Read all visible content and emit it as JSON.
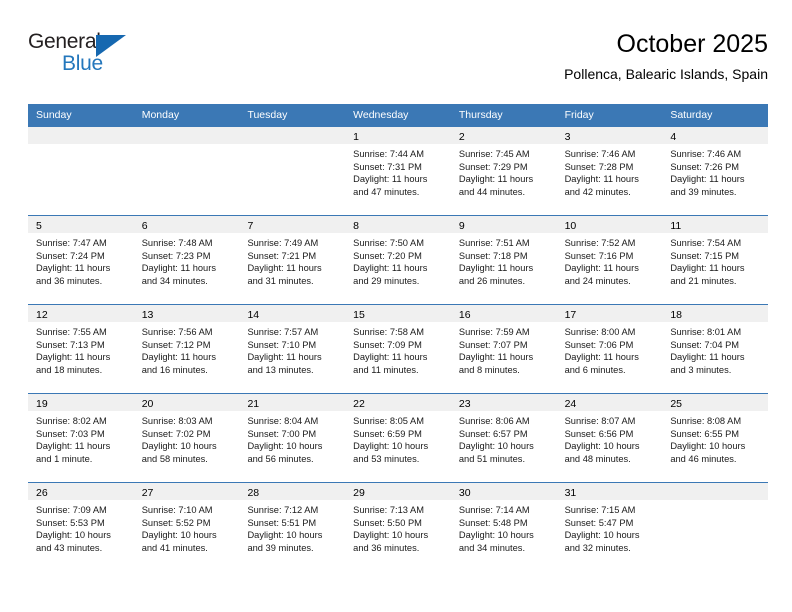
{
  "brand": {
    "name_top": "General",
    "name_bottom": "Blue",
    "flag_icon": "blue-flag-triangle",
    "color_dark": "#231f20",
    "color_blue": "#2477bc"
  },
  "header": {
    "title": "October 2025",
    "location": "Pollenca, Balearic Islands, Spain"
  },
  "theme": {
    "header_blue": "#3b78b5",
    "daynum_band": "#f0f0f0",
    "text": "#000000"
  },
  "weekday_headers": [
    "Sunday",
    "Monday",
    "Tuesday",
    "Wednesday",
    "Thursday",
    "Friday",
    "Saturday"
  ],
  "weeks": [
    {
      "days": [
        {
          "day": "",
          "empty": true,
          "lines": [
            "",
            "",
            "",
            ""
          ]
        },
        {
          "day": "",
          "empty": true,
          "lines": [
            "",
            "",
            "",
            ""
          ]
        },
        {
          "day": "",
          "empty": true,
          "lines": [
            "",
            "",
            "",
            ""
          ]
        },
        {
          "day": "1",
          "empty": false,
          "lines": [
            "Sunrise: 7:44 AM",
            "Sunset: 7:31 PM",
            "Daylight: 11 hours",
            "and 47 minutes."
          ]
        },
        {
          "day": "2",
          "empty": false,
          "lines": [
            "Sunrise: 7:45 AM",
            "Sunset: 7:29 PM",
            "Daylight: 11 hours",
            "and 44 minutes."
          ]
        },
        {
          "day": "3",
          "empty": false,
          "lines": [
            "Sunrise: 7:46 AM",
            "Sunset: 7:28 PM",
            "Daylight: 11 hours",
            "and 42 minutes."
          ]
        },
        {
          "day": "4",
          "empty": false,
          "lines": [
            "Sunrise: 7:46 AM",
            "Sunset: 7:26 PM",
            "Daylight: 11 hours",
            "and 39 minutes."
          ]
        }
      ]
    },
    {
      "days": [
        {
          "day": "5",
          "empty": false,
          "lines": [
            "Sunrise: 7:47 AM",
            "Sunset: 7:24 PM",
            "Daylight: 11 hours",
            "and 36 minutes."
          ]
        },
        {
          "day": "6",
          "empty": false,
          "lines": [
            "Sunrise: 7:48 AM",
            "Sunset: 7:23 PM",
            "Daylight: 11 hours",
            "and 34 minutes."
          ]
        },
        {
          "day": "7",
          "empty": false,
          "lines": [
            "Sunrise: 7:49 AM",
            "Sunset: 7:21 PM",
            "Daylight: 11 hours",
            "and 31 minutes."
          ]
        },
        {
          "day": "8",
          "empty": false,
          "lines": [
            "Sunrise: 7:50 AM",
            "Sunset: 7:20 PM",
            "Daylight: 11 hours",
            "and 29 minutes."
          ]
        },
        {
          "day": "9",
          "empty": false,
          "lines": [
            "Sunrise: 7:51 AM",
            "Sunset: 7:18 PM",
            "Daylight: 11 hours",
            "and 26 minutes."
          ]
        },
        {
          "day": "10",
          "empty": false,
          "lines": [
            "Sunrise: 7:52 AM",
            "Sunset: 7:16 PM",
            "Daylight: 11 hours",
            "and 24 minutes."
          ]
        },
        {
          "day": "11",
          "empty": false,
          "lines": [
            "Sunrise: 7:54 AM",
            "Sunset: 7:15 PM",
            "Daylight: 11 hours",
            "and 21 minutes."
          ]
        }
      ]
    },
    {
      "days": [
        {
          "day": "12",
          "empty": false,
          "lines": [
            "Sunrise: 7:55 AM",
            "Sunset: 7:13 PM",
            "Daylight: 11 hours",
            "and 18 minutes."
          ]
        },
        {
          "day": "13",
          "empty": false,
          "lines": [
            "Sunrise: 7:56 AM",
            "Sunset: 7:12 PM",
            "Daylight: 11 hours",
            "and 16 minutes."
          ]
        },
        {
          "day": "14",
          "empty": false,
          "lines": [
            "Sunrise: 7:57 AM",
            "Sunset: 7:10 PM",
            "Daylight: 11 hours",
            "and 13 minutes."
          ]
        },
        {
          "day": "15",
          "empty": false,
          "lines": [
            "Sunrise: 7:58 AM",
            "Sunset: 7:09 PM",
            "Daylight: 11 hours",
            "and 11 minutes."
          ]
        },
        {
          "day": "16",
          "empty": false,
          "lines": [
            "Sunrise: 7:59 AM",
            "Sunset: 7:07 PM",
            "Daylight: 11 hours",
            "and 8 minutes."
          ]
        },
        {
          "day": "17",
          "empty": false,
          "lines": [
            "Sunrise: 8:00 AM",
            "Sunset: 7:06 PM",
            "Daylight: 11 hours",
            "and 6 minutes."
          ]
        },
        {
          "day": "18",
          "empty": false,
          "lines": [
            "Sunrise: 8:01 AM",
            "Sunset: 7:04 PM",
            "Daylight: 11 hours",
            "and 3 minutes."
          ]
        }
      ]
    },
    {
      "days": [
        {
          "day": "19",
          "empty": false,
          "lines": [
            "Sunrise: 8:02 AM",
            "Sunset: 7:03 PM",
            "Daylight: 11 hours",
            "and 1 minute."
          ]
        },
        {
          "day": "20",
          "empty": false,
          "lines": [
            "Sunrise: 8:03 AM",
            "Sunset: 7:02 PM",
            "Daylight: 10 hours",
            "and 58 minutes."
          ]
        },
        {
          "day": "21",
          "empty": false,
          "lines": [
            "Sunrise: 8:04 AM",
            "Sunset: 7:00 PM",
            "Daylight: 10 hours",
            "and 56 minutes."
          ]
        },
        {
          "day": "22",
          "empty": false,
          "lines": [
            "Sunrise: 8:05 AM",
            "Sunset: 6:59 PM",
            "Daylight: 10 hours",
            "and 53 minutes."
          ]
        },
        {
          "day": "23",
          "empty": false,
          "lines": [
            "Sunrise: 8:06 AM",
            "Sunset: 6:57 PM",
            "Daylight: 10 hours",
            "and 51 minutes."
          ]
        },
        {
          "day": "24",
          "empty": false,
          "lines": [
            "Sunrise: 8:07 AM",
            "Sunset: 6:56 PM",
            "Daylight: 10 hours",
            "and 48 minutes."
          ]
        },
        {
          "day": "25",
          "empty": false,
          "lines": [
            "Sunrise: 8:08 AM",
            "Sunset: 6:55 PM",
            "Daylight: 10 hours",
            "and 46 minutes."
          ]
        }
      ]
    },
    {
      "days": [
        {
          "day": "26",
          "empty": false,
          "lines": [
            "Sunrise: 7:09 AM",
            "Sunset: 5:53 PM",
            "Daylight: 10 hours",
            "and 43 minutes."
          ]
        },
        {
          "day": "27",
          "empty": false,
          "lines": [
            "Sunrise: 7:10 AM",
            "Sunset: 5:52 PM",
            "Daylight: 10 hours",
            "and 41 minutes."
          ]
        },
        {
          "day": "28",
          "empty": false,
          "lines": [
            "Sunrise: 7:12 AM",
            "Sunset: 5:51 PM",
            "Daylight: 10 hours",
            "and 39 minutes."
          ]
        },
        {
          "day": "29",
          "empty": false,
          "lines": [
            "Sunrise: 7:13 AM",
            "Sunset: 5:50 PM",
            "Daylight: 10 hours",
            "and 36 minutes."
          ]
        },
        {
          "day": "30",
          "empty": false,
          "lines": [
            "Sunrise: 7:14 AM",
            "Sunset: 5:48 PM",
            "Daylight: 10 hours",
            "and 34 minutes."
          ]
        },
        {
          "day": "31",
          "empty": false,
          "lines": [
            "Sunrise: 7:15 AM",
            "Sunset: 5:47 PM",
            "Daylight: 10 hours",
            "and 32 minutes."
          ]
        },
        {
          "day": "",
          "empty": true,
          "lines": [
            "",
            "",
            "",
            ""
          ]
        }
      ]
    }
  ]
}
